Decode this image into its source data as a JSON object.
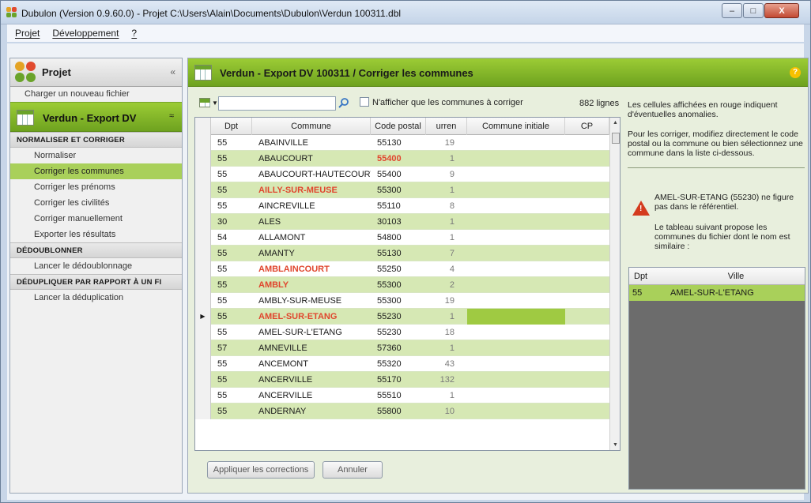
{
  "window": {
    "title": "Dubulon (Version 0.9.60.0) - Projet C:\\Users\\Alain\\Documents\\Dubulon\\Verdun 100311.dbl",
    "min": "–",
    "max": "□",
    "close": "X"
  },
  "menu": [
    "Projet",
    "Développement",
    "?"
  ],
  "left": {
    "header": "Projet",
    "collapse": "«",
    "load_link": "Charger un nouveau fichier",
    "section_title": "Verdun - Export DV",
    "section_chevron": "≈",
    "groups": [
      {
        "title": "NORMALISER ET CORRIGER",
        "items": [
          "Normaliser",
          "Corriger les communes",
          "Corriger les prénoms",
          "Corriger les civilités",
          "Corriger manuellement",
          "Exporter les résultats"
        ]
      },
      {
        "title": "DÉDOUBLONNER",
        "items": [
          "Lancer le dédoublonnage"
        ]
      },
      {
        "title": "DÉDUPLIQUER PAR RAPPORT À UN FI",
        "items": [
          "Lancer la déduplication"
        ]
      }
    ],
    "active_item": "Corriger les communes"
  },
  "main": {
    "title": "Verdun - Export DV 100311 / Corriger les communes",
    "help": "?",
    "search_value": "",
    "checkbox_label": "N'afficher que les communes à corriger",
    "line_count": "882 lignes",
    "columns": [
      "Dpt",
      "Commune",
      "Code postal",
      "urren",
      "Commune initiale",
      "CP"
    ],
    "rows": [
      {
        "dpt": "55",
        "commune": "ABAINVILLE",
        "cp": "55130",
        "occ": "19",
        "red_commune": false,
        "red_cp": false
      },
      {
        "dpt": "55",
        "commune": "ABAUCOURT",
        "cp": "55400",
        "occ": "1",
        "red_commune": false,
        "red_cp": true
      },
      {
        "dpt": "55",
        "commune": "ABAUCOURT-HAUTECOURT",
        "cp": "55400",
        "occ": "9",
        "red_commune": false,
        "red_cp": false
      },
      {
        "dpt": "55",
        "commune": "AILLY-SUR-MEUSE",
        "cp": "55300",
        "occ": "1",
        "red_commune": true,
        "red_cp": false
      },
      {
        "dpt": "55",
        "commune": "AINCREVILLE",
        "cp": "55110",
        "occ": "8",
        "red_commune": false,
        "red_cp": false
      },
      {
        "dpt": "30",
        "commune": "ALES",
        "cp": "30103",
        "occ": "1",
        "red_commune": false,
        "red_cp": false
      },
      {
        "dpt": "54",
        "commune": "ALLAMONT",
        "cp": "54800",
        "occ": "1",
        "red_commune": false,
        "red_cp": false
      },
      {
        "dpt": "55",
        "commune": "AMANTY",
        "cp": "55130",
        "occ": "7",
        "red_commune": false,
        "red_cp": false
      },
      {
        "dpt": "55",
        "commune": "AMBLAINCOURT",
        "cp": "55250",
        "occ": "4",
        "red_commune": true,
        "red_cp": false
      },
      {
        "dpt": "55",
        "commune": "AMBLY",
        "cp": "55300",
        "occ": "2",
        "red_commune": true,
        "red_cp": false
      },
      {
        "dpt": "55",
        "commune": "AMBLY-SUR-MEUSE",
        "cp": "55300",
        "occ": "19",
        "red_commune": false,
        "red_cp": false
      },
      {
        "dpt": "55",
        "commune": "AMEL-SUR-ETANG",
        "cp": "55230",
        "occ": "1",
        "red_commune": true,
        "red_cp": false,
        "current": true
      },
      {
        "dpt": "55",
        "commune": "AMEL-SUR-L'ETANG",
        "cp": "55230",
        "occ": "18",
        "red_commune": false,
        "red_cp": false
      },
      {
        "dpt": "57",
        "commune": "AMNEVILLE",
        "cp": "57360",
        "occ": "1",
        "red_commune": false,
        "red_cp": false
      },
      {
        "dpt": "55",
        "commune": "ANCEMONT",
        "cp": "55320",
        "occ": "43",
        "red_commune": false,
        "red_cp": false
      },
      {
        "dpt": "55",
        "commune": "ANCERVILLE",
        "cp": "55170",
        "occ": "132",
        "red_commune": false,
        "red_cp": false
      },
      {
        "dpt": "55",
        "commune": "ANCERVILLE",
        "cp": "55510",
        "occ": "1",
        "red_commune": false,
        "red_cp": false
      },
      {
        "dpt": "55",
        "commune": "ANDERNAY",
        "cp": "55800",
        "occ": "10",
        "red_commune": false,
        "red_cp": false
      }
    ],
    "apply_button": "Appliquer les corrections",
    "cancel_button": "Annuler"
  },
  "side": {
    "info1": "Les cellules affichées en rouge indiquent d'éventuelles anomalies.",
    "info2": "Pour les corriger, modifiez directement le code postal ou la commune ou bien sélectionnez une commune dans la liste ci-dessous.",
    "warning": "AMEL-SUR-ETANG (55230) ne figure pas dans le référentiel.",
    "info3": "Le tableau suivant propose les communes du fichier dont le nom est similaire :",
    "columns": [
      "Dpt",
      "Ville"
    ],
    "suggestion": {
      "dpt": "55",
      "ville": "AMEL-SUR-L'ETANG"
    }
  },
  "colors": {
    "accent": "#9ccc35",
    "row_alt": "#d6e8b4",
    "anomaly": "#e0462e"
  }
}
